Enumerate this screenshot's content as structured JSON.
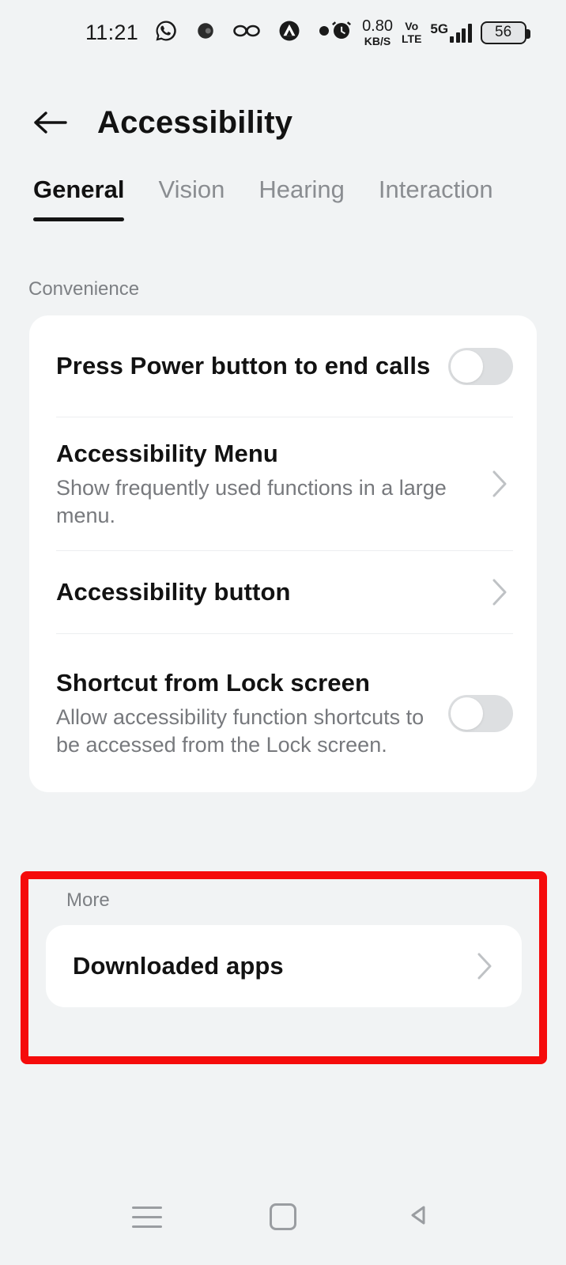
{
  "status_bar": {
    "time": "11:21",
    "icons": [
      "whatsapp-icon",
      "circle-app-icon",
      "glasses-icon",
      "triangle-circle-icon",
      "dot-icon"
    ],
    "net_speed_value": "0.80",
    "net_speed_unit": "KB/S",
    "volte_line1": "Vo",
    "volte_line2": "LTE",
    "network_type": "5G",
    "battery_level": "56"
  },
  "header": {
    "title": "Accessibility",
    "back_label": "Back"
  },
  "tabs": [
    {
      "label": "General",
      "active": true
    },
    {
      "label": "Vision",
      "active": false
    },
    {
      "label": "Hearing",
      "active": false
    },
    {
      "label": "Interaction",
      "active": false
    }
  ],
  "sections": [
    {
      "label": "Convenience",
      "rows": [
        {
          "title": "Press Power button to end calls",
          "subtitle": "",
          "control": "toggle",
          "toggle_state": "off"
        },
        {
          "title": "Accessibility Menu",
          "subtitle": "Show frequently used functions in a large menu.",
          "control": "chevron",
          "toggle_state": ""
        },
        {
          "title": "Accessibility button",
          "subtitle": "",
          "control": "chevron",
          "toggle_state": ""
        },
        {
          "title": "Shortcut from Lock screen",
          "subtitle": "Allow accessibility function shortcuts to be accessed from the Lock screen.",
          "control": "toggle",
          "toggle_state": "off"
        }
      ]
    },
    {
      "label": "More",
      "highlighted": true,
      "rows": [
        {
          "title": "Downloaded apps",
          "subtitle": "",
          "control": "chevron",
          "toggle_state": ""
        }
      ]
    }
  ],
  "highlight": {
    "color": "#f50b0b"
  },
  "nav_bar": {
    "recents_label": "Recents",
    "home_label": "Home",
    "back_label": "Back"
  },
  "colors": {
    "background": "#f1f3f4",
    "card": "#ffffff",
    "text_primary": "#121212",
    "text_secondary": "#77797d",
    "accent_highlight": "#f50b0b"
  }
}
